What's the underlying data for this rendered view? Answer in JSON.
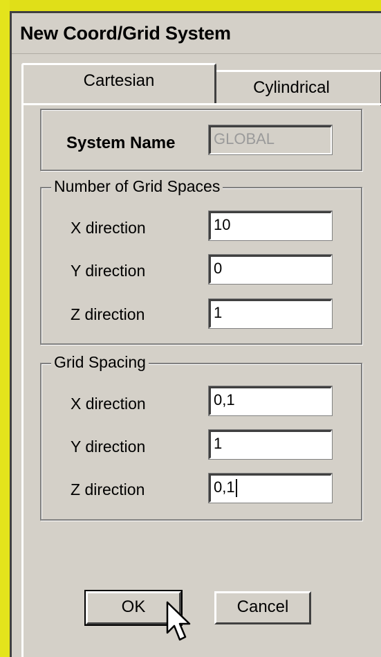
{
  "window": {
    "title": "New Coord/Grid System"
  },
  "tabs": [
    {
      "label": "Cartesian",
      "active": true
    },
    {
      "label": "Cylindrical",
      "active": false
    }
  ],
  "system_name": {
    "label": "System Name",
    "value": "GLOBAL",
    "disabled": true
  },
  "grid_spaces": {
    "legend": "Number of Grid Spaces",
    "rows": [
      {
        "label": "X direction",
        "value": "10"
      },
      {
        "label": "Y direction",
        "value": "0"
      },
      {
        "label": "Z direction",
        "value": "1"
      }
    ]
  },
  "grid_spacing": {
    "legend": "Grid Spacing",
    "rows": [
      {
        "label": "X direction",
        "value": "0,1"
      },
      {
        "label": "Y direction",
        "value": "1"
      },
      {
        "label": "Z direction",
        "value": "0,1"
      }
    ]
  },
  "buttons": {
    "ok": "OK",
    "cancel": "Cancel"
  },
  "icons": {
    "cursor": "mouse-pointer-icon"
  },
  "colors": {
    "dialog_bg": "#d4d0c8",
    "background": "#e0df18"
  }
}
